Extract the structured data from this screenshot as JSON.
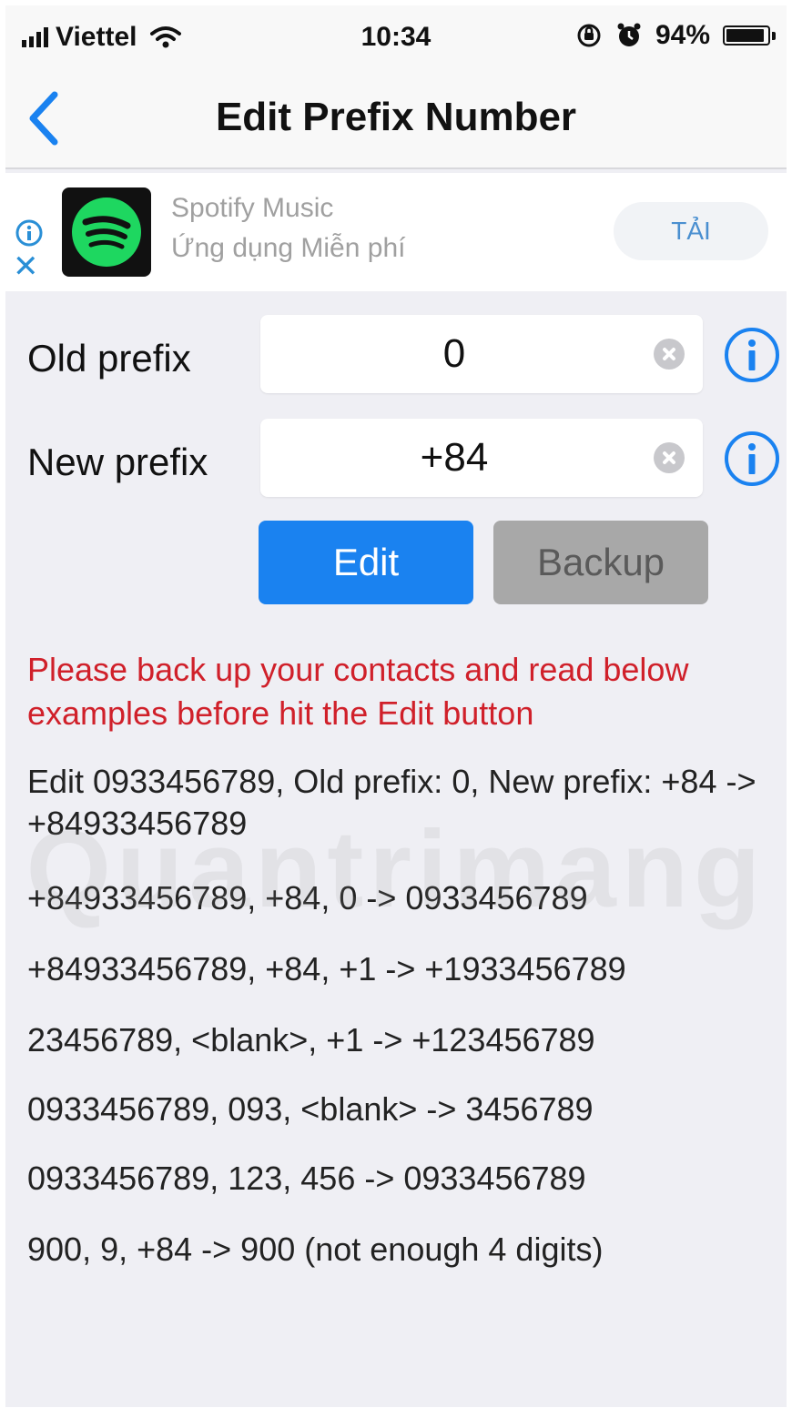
{
  "status_bar": {
    "carrier": "Viettel",
    "time": "10:34",
    "battery": "94%",
    "battery_level": 0.94
  },
  "nav": {
    "title": "Edit Prefix Number"
  },
  "ad": {
    "title": "Spotify Music",
    "subtitle": "Ứng dụng Miễn phí",
    "cta": "TẢI"
  },
  "form": {
    "old_prefix_label": "Old prefix",
    "old_prefix_value": "0",
    "new_prefix_label": "New prefix",
    "new_prefix_value": "+84",
    "edit_label": "Edit",
    "backup_label": "Backup"
  },
  "warning": "Please back up your contacts and read below examples before hit the Edit button",
  "examples": [
    "Edit 0933456789, Old prefix: 0, New prefix: +84 -> +84933456789",
    "+84933456789, +84, 0 -> 0933456789",
    "+84933456789, +84, +1 -> +1933456789",
    "23456789, <blank>, +1 -> +123456789",
    "0933456789, 093, <blank> -> 3456789",
    "0933456789, 123, 456 -> 0933456789",
    "900, 9, +84 -> 900 (not enough 4 digits)"
  ],
  "watermark": "Quantrimang",
  "colors": {
    "accent": "#1a82f0",
    "warning": "#d0202a",
    "disabled": "#a8a8a8"
  }
}
